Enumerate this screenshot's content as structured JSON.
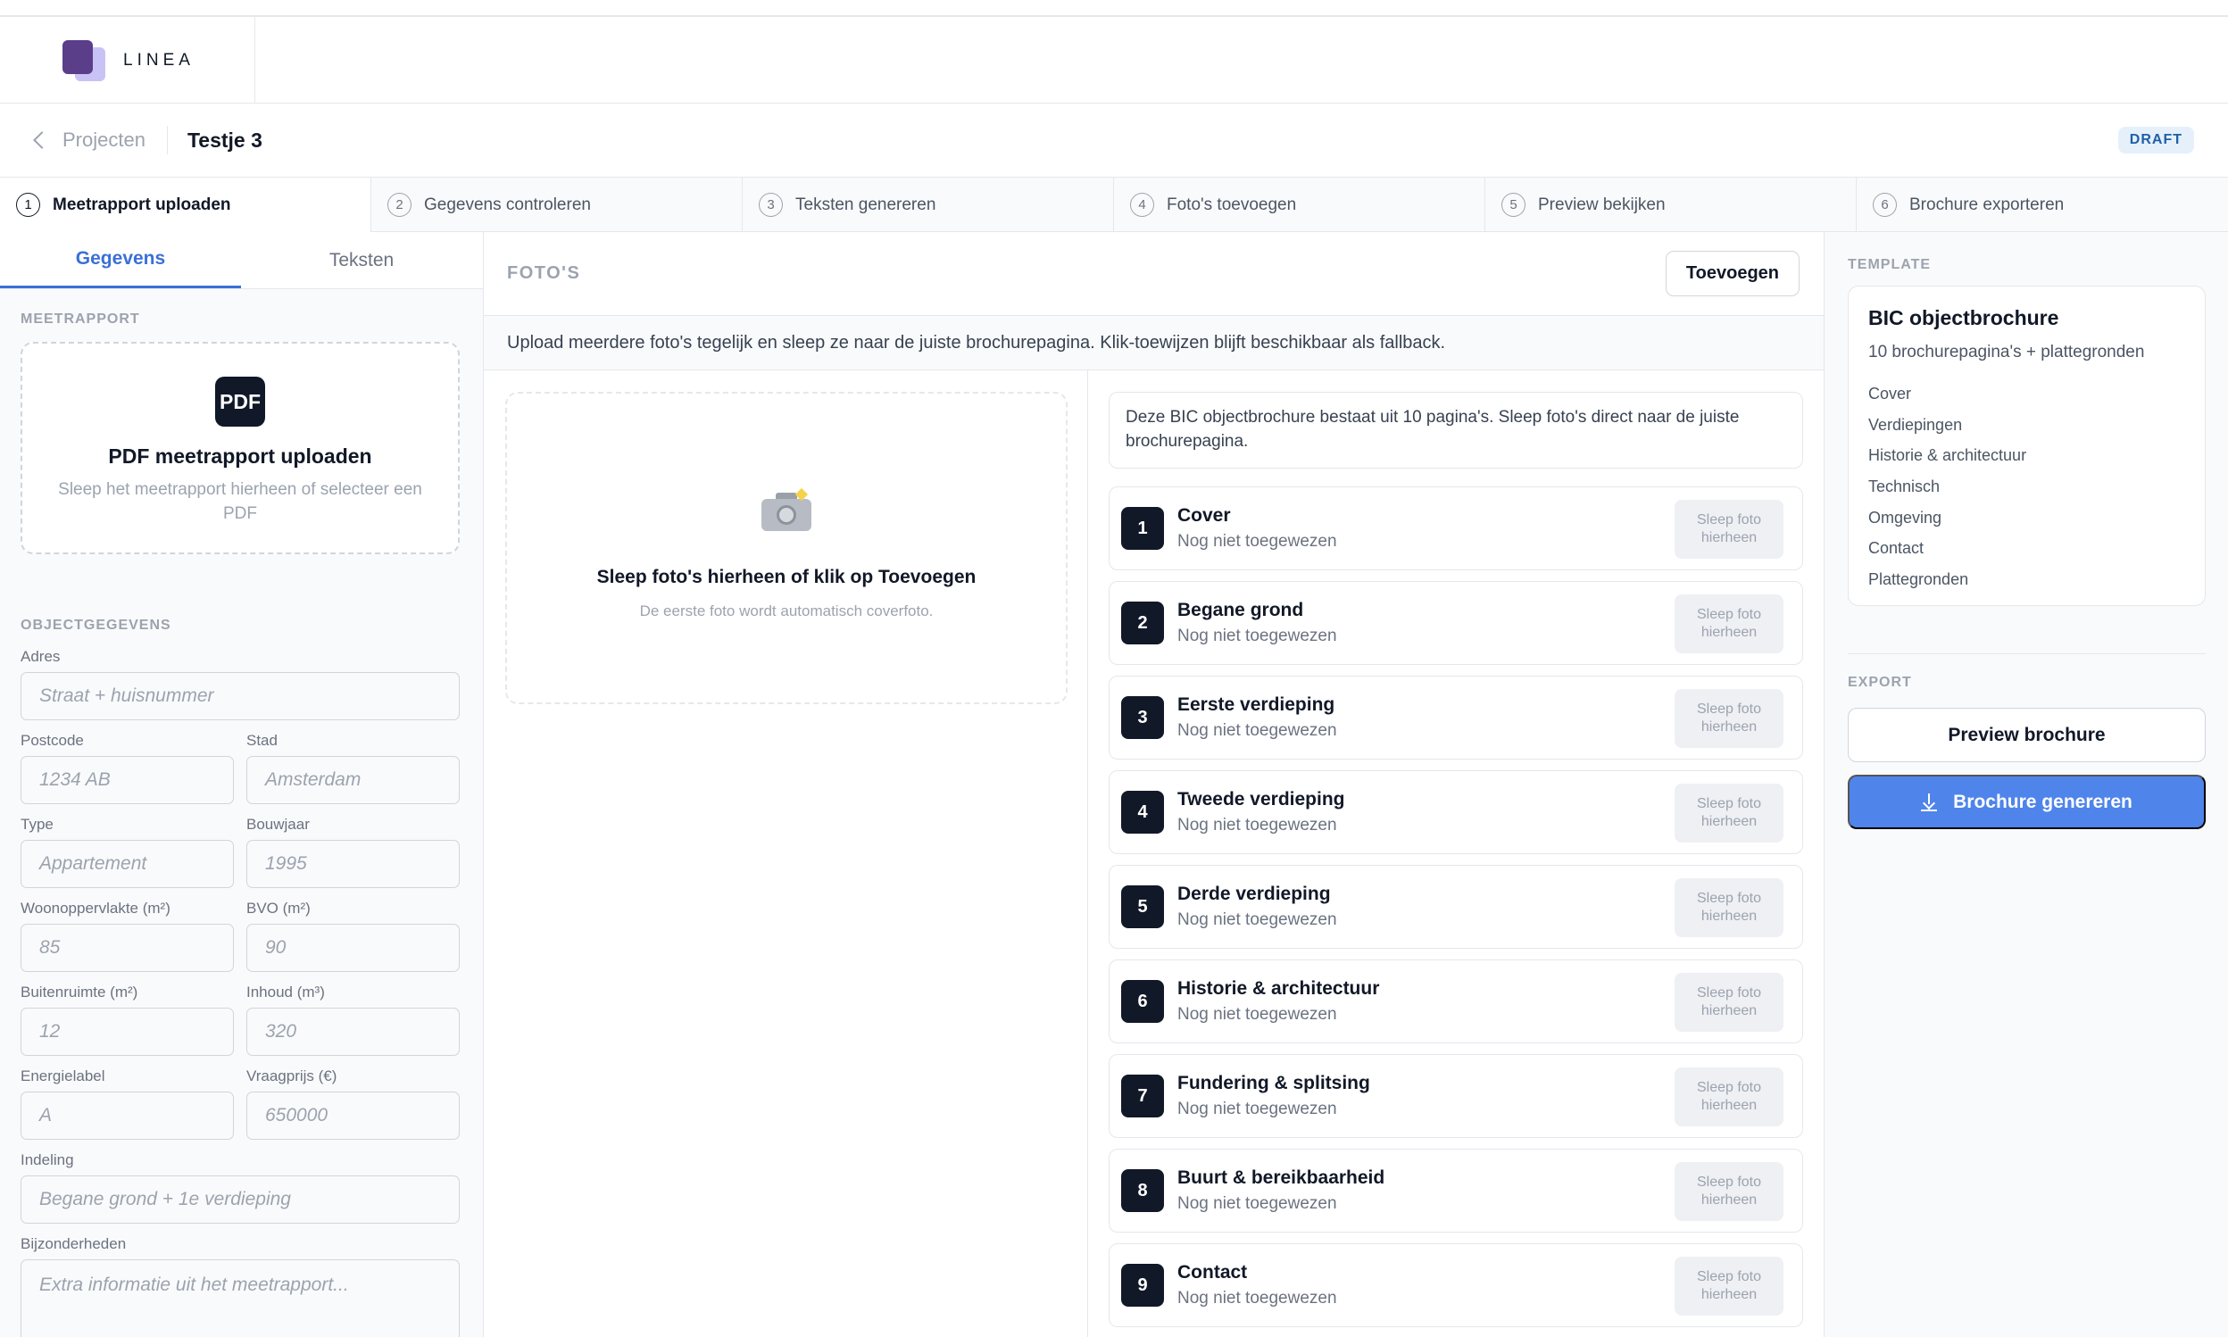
{
  "app": {
    "brand": "LINEA"
  },
  "project": {
    "back_label": "Projecten",
    "title": "Testje 3",
    "status": "DRAFT"
  },
  "steps": [
    {
      "num": "1",
      "label": "Meetrapport uploaden"
    },
    {
      "num": "2",
      "label": "Gegevens controleren"
    },
    {
      "num": "3",
      "label": "Teksten genereren"
    },
    {
      "num": "4",
      "label": "Foto's toevoegen"
    },
    {
      "num": "5",
      "label": "Preview bekijken"
    },
    {
      "num": "6",
      "label": "Brochure exporteren"
    }
  ],
  "left": {
    "tabs": [
      "Gegevens",
      "Teksten"
    ],
    "meetrapport_label": "MEETRAPPORT",
    "upload": {
      "icon_text": "PDF",
      "title": "PDF meetrapport uploaden",
      "hint": "Sleep het meetrapport hierheen of selecteer een PDF"
    },
    "objectgegevens_label": "OBJECTGEGEVENS",
    "fields": {
      "adres": {
        "label": "Adres",
        "placeholder": "Straat + huisnummer"
      },
      "postcode": {
        "label": "Postcode",
        "placeholder": "1234 AB"
      },
      "stad": {
        "label": "Stad",
        "placeholder": "Amsterdam"
      },
      "type": {
        "label": "Type",
        "placeholder": "Appartement"
      },
      "bouwjaar": {
        "label": "Bouwjaar",
        "placeholder": "1995"
      },
      "woonopp": {
        "label": "Woonoppervlakte (m²)",
        "placeholder": "85"
      },
      "bvo": {
        "label": "BVO (m²)",
        "placeholder": "90"
      },
      "buitenruimte": {
        "label": "Buitenruimte (m²)",
        "placeholder": "12"
      },
      "inhoud": {
        "label": "Inhoud (m³)",
        "placeholder": "320"
      },
      "energielabel": {
        "label": "Energielabel",
        "placeholder": "A"
      },
      "vraagprijs": {
        "label": "Vraagprijs (€)",
        "placeholder": "650000"
      },
      "indeling": {
        "label": "Indeling",
        "placeholder": "Begane grond + 1e verdieping"
      },
      "bijzonderheden": {
        "label": "Bijzonderheden",
        "placeholder": "Extra informatie uit het meetrapport..."
      }
    }
  },
  "middle": {
    "title": "FOTO'S",
    "add_button": "Toevoegen",
    "hint": "Upload meerdere foto's tegelijk en sleep ze naar de juiste brochurepagina. Klik-toewijzen blijft beschikbaar als fallback.",
    "dropzone": {
      "title": "Sleep foto's hierheen of klik op Toevoegen",
      "sub": "De eerste foto wordt automatisch coverfoto."
    },
    "info": "Deze BIC objectbrochure bestaat uit 10 pagina's. Sleep foto's direct naar de juiste brochurepagina.",
    "slot_label": "Sleep foto hierheen",
    "pages": [
      {
        "num": "1",
        "name": "Cover",
        "status": "Nog niet toegewezen"
      },
      {
        "num": "2",
        "name": "Begane grond",
        "status": "Nog niet toegewezen"
      },
      {
        "num": "3",
        "name": "Eerste verdieping",
        "status": "Nog niet toegewezen"
      },
      {
        "num": "4",
        "name": "Tweede verdieping",
        "status": "Nog niet toegewezen"
      },
      {
        "num": "5",
        "name": "Derde verdieping",
        "status": "Nog niet toegewezen"
      },
      {
        "num": "6",
        "name": "Historie & architectuur",
        "status": "Nog niet toegewezen"
      },
      {
        "num": "7",
        "name": "Fundering & splitsing",
        "status": "Nog niet toegewezen"
      },
      {
        "num": "8",
        "name": "Buurt & bereikbaarheid",
        "status": "Nog niet toegewezen"
      },
      {
        "num": "9",
        "name": "Contact",
        "status": "Nog niet toegewezen"
      }
    ]
  },
  "right": {
    "template_label": "TEMPLATE",
    "template": {
      "name": "BIC objectbrochure",
      "sub": "10 brochurepagina's + plattegronden",
      "sections": [
        "Cover",
        "Verdiepingen",
        "Historie & architectuur",
        "Technisch",
        "Omgeving",
        "Contact",
        "Plattegronden"
      ]
    },
    "export_label": "EXPORT",
    "preview_button": "Preview brochure",
    "generate_button": "Brochure genereren"
  },
  "colors": {
    "accent": "#4f84ea",
    "tab_active": "#3b6fd8",
    "dark": "#111827",
    "draft_bg": "#e6f0fb"
  }
}
